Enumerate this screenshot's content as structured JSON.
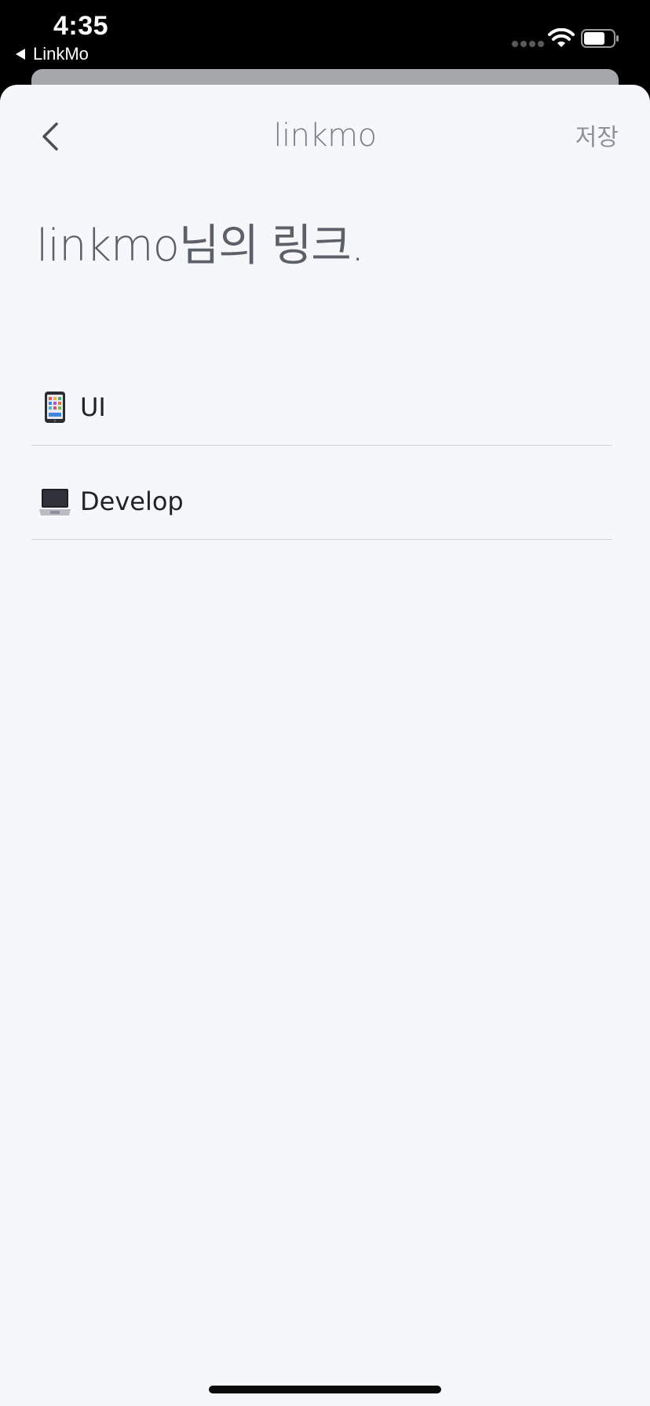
{
  "status_bar": {
    "time": "4:35",
    "back_app": "LinkMo"
  },
  "nav": {
    "title": "linkmo",
    "save_label": "저장",
    "back_icon": "chevron-left-icon"
  },
  "page": {
    "heading": "linkmo님의 링크."
  },
  "list": {
    "items": [
      {
        "label": "UI",
        "icon": "mobile-phone-icon"
      },
      {
        "label": "Develop",
        "icon": "laptop-icon"
      }
    ]
  },
  "colors": {
    "sheet_background": "#f5f7fa",
    "divider": "#cfd2d7",
    "title_gray": "#7b7f88"
  }
}
